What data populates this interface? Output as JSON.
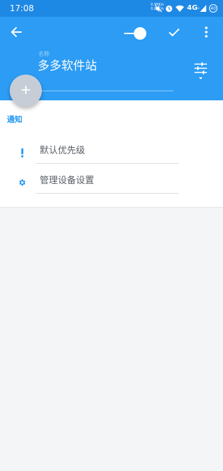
{
  "status_bar": {
    "time": "17:08",
    "net_up": "0.95K/s",
    "net_down": "0.83K/s",
    "network": "4G",
    "network_sub": "²",
    "battery_badge": "40",
    "icons": [
      "mute-icon",
      "alarm-icon",
      "wifi-icon",
      "signal-icon",
      "battery-icon"
    ]
  },
  "app_bar": {
    "back_icon": "arrow-left-icon",
    "toggle_on": true,
    "check_icon": "check-icon",
    "more_icon": "more-vertical-icon",
    "name_label": "名称",
    "name_value": "多多软件站",
    "filter_icon": "tune-sliders-icon"
  },
  "fab": {
    "icon": "plus-icon"
  },
  "notifications": {
    "section_title": "通知",
    "rows": [
      {
        "icon": "exclamation-icon",
        "label": "默认优先级"
      },
      {
        "icon": "gear-icon",
        "label": "管理设备设置"
      }
    ]
  },
  "colors": {
    "status_bar": "#1E88E5",
    "app_bar": "#2C9CF4",
    "accent": "#1E96F0",
    "fab": "#C7CDD6",
    "background": "#F4F5F7"
  }
}
